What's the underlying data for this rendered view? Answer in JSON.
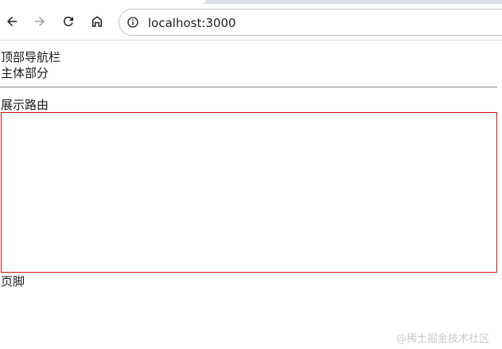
{
  "browser": {
    "url": "localhost:3000",
    "icons": {
      "back": "arrow-left-icon",
      "forward": "arrow-right-icon",
      "reload": "reload-icon",
      "home": "home-icon",
      "site_info": "info-icon"
    }
  },
  "page": {
    "top_nav_text": "顶部导航栏",
    "main_text": "主体部分",
    "route_label": "展示路由",
    "footer_text": "页脚"
  },
  "watermark": "@稀土掘金技术社区",
  "colors": {
    "route_border": "#c81414",
    "divider": "#8a8a8a",
    "forward_disabled": "#9aa0a6"
  }
}
